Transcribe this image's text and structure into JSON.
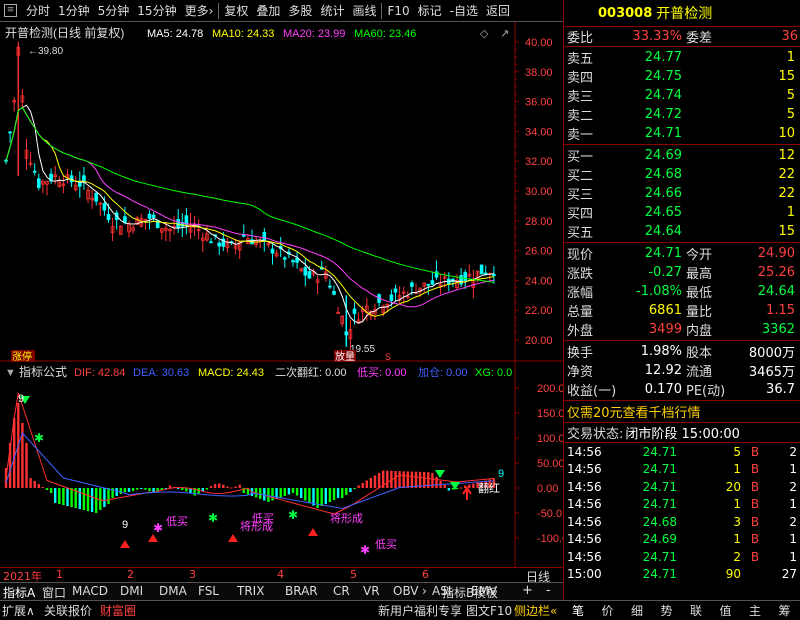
{
  "toolbar": {
    "items": [
      "分时",
      "1分钟",
      "5分钟",
      "15分钟",
      "更多›",
      "复权",
      "叠加",
      "多股",
      "统计",
      "画线",
      "F10",
      "标记",
      "-自选",
      "返回"
    ]
  },
  "chart": {
    "title": "开普检测(日线 前复权)",
    "ma5": "MA5: 24.78",
    "ma10": "MA10: 24.33",
    "ma20": "MA20: 23.99",
    "ma60": "MA60: 23.46",
    "price_axis": [
      "40.00",
      "38.00",
      "36.00",
      "34.00",
      "32.00",
      "30.00",
      "28.00",
      "26.00",
      "24.00",
      "22.00",
      "20.00"
    ],
    "high_label": "39.80",
    "low_label": "19.55",
    "tag_left": "涨停",
    "tag_mid": "放量",
    "tag_s": "S",
    "colors": {
      "ma5": "#ffffff",
      "ma10": "#ffff00",
      "ma20": "#ff40ff",
      "ma60": "#00ff00",
      "up": "#ff3030",
      "down": "#00ffff"
    }
  },
  "indicator": {
    "title": "指标公式",
    "dif": "DIF: 42.84",
    "dea": "DEA: 30.63",
    "macd": "MACD: 24.43",
    "erci": "二次翻红: 0.00",
    "dimai": "低买: 0.00",
    "jiagu": "加仓: 0.00",
    "xg": "XG: 0.0",
    "axis": [
      "200.0",
      "150.0",
      "100.0",
      "50.00",
      "0.00",
      "-50.0",
      "-100.0"
    ],
    "labels": {
      "low_buy1": "低买",
      "low_buy2": "低买",
      "low_buy3": "低买",
      "form1": "将形成",
      "form2": "将形成",
      "fanhong": "翻红",
      "n9a": "9",
      "n9b": "9",
      "n9c": "9"
    }
  },
  "timeline": {
    "year": "2021年",
    "months": [
      "1",
      "2",
      "3",
      "4",
      "5",
      "6"
    ],
    "period": "日线"
  },
  "tabs": [
    "指标A",
    "窗口",
    "MACD",
    "DMI",
    "DMA",
    "FSL",
    "TRIX",
    "BRAR",
    "CR",
    "VR",
    "OBV",
    "ASI",
    "EMV"
  ],
  "tabs_right": [
    "指标B",
    "模板"
  ],
  "tab_more": "›",
  "tab_plus": "+",
  "tab_minus": "-",
  "bottom": {
    "left": [
      "扩展∧",
      "关联报价",
      "财富圈"
    ],
    "promo": "新用户福利专享",
    "f10": "图文F10",
    "side": "侧边栏«",
    "right_tabs": [
      "笔",
      "价",
      "细",
      "势",
      "联",
      "值",
      "主",
      "筹"
    ]
  },
  "quote": {
    "code": "003008",
    "name": "开普检测",
    "weibi_label": "委比",
    "weibi": "33.33%",
    "weicha_label": "委差",
    "weicha": "36",
    "sell": [
      {
        "label": "卖五",
        "price": "24.77",
        "vol": "1"
      },
      {
        "label": "卖四",
        "price": "24.75",
        "vol": "15"
      },
      {
        "label": "卖三",
        "price": "24.74",
        "vol": "5"
      },
      {
        "label": "卖二",
        "price": "24.72",
        "vol": "5"
      },
      {
        "label": "卖一",
        "price": "24.71",
        "vol": "10"
      }
    ],
    "buy": [
      {
        "label": "买一",
        "price": "24.69",
        "vol": "12"
      },
      {
        "label": "买二",
        "price": "24.68",
        "vol": "22"
      },
      {
        "label": "买三",
        "price": "24.66",
        "vol": "22"
      },
      {
        "label": "买四",
        "price": "24.65",
        "vol": "1"
      },
      {
        "label": "买五",
        "price": "24.64",
        "vol": "15"
      }
    ],
    "stats": [
      {
        "l1": "现价",
        "v1": "24.71",
        "c1": "grn",
        "l2": "今开",
        "v2": "24.90",
        "c2": "red"
      },
      {
        "l1": "涨跌",
        "v1": "-0.27",
        "c1": "grn",
        "l2": "最高",
        "v2": "25.26",
        "c2": "red"
      },
      {
        "l1": "涨幅",
        "v1": "-1.08%",
        "c1": "grn",
        "l2": "最低",
        "v2": "24.64",
        "c2": "grn"
      },
      {
        "l1": "总量",
        "v1": "6861",
        "c1": "yel",
        "l2": "量比",
        "v2": "1.15",
        "c2": "red"
      },
      {
        "l1": "外盘",
        "v1": "3499",
        "c1": "red",
        "l2": "内盘",
        "v2": "3362",
        "c2": "grn"
      }
    ],
    "stats2": [
      {
        "l1": "换手",
        "v1": "1.98%",
        "l2": "股本",
        "v2": "8000万"
      },
      {
        "l1": "净资",
        "v1": "12.92",
        "l2": "流通",
        "v2": "3465万"
      },
      {
        "l1": "收益(一)",
        "v1": "0.170",
        "l2": "PE(动)",
        "v2": "36.7"
      }
    ],
    "promo": "仅需20元查看千档行情",
    "status_label": "交易状态:",
    "status": "闭市阶段 15:00:00",
    "ticks": [
      {
        "t": "14:56",
        "p": "24.71",
        "v": "5",
        "bs": "B",
        "n": "2"
      },
      {
        "t": "14:56",
        "p": "24.71",
        "v": "1",
        "bs": "B",
        "n": "1"
      },
      {
        "t": "14:56",
        "p": "24.71",
        "v": "20",
        "bs": "B",
        "n": "2"
      },
      {
        "t": "14:56",
        "p": "24.71",
        "v": "1",
        "bs": "B",
        "n": "1"
      },
      {
        "t": "14:56",
        "p": "24.68",
        "v": "3",
        "bs": "B",
        "n": "2"
      },
      {
        "t": "14:56",
        "p": "24.69",
        "v": "1",
        "bs": "B",
        "n": "1"
      },
      {
        "t": "14:56",
        "p": "24.71",
        "v": "2",
        "bs": "B",
        "n": "1"
      },
      {
        "t": "15:00",
        "p": "24.71",
        "v": "90",
        "bs": "",
        "n": "27"
      }
    ]
  }
}
